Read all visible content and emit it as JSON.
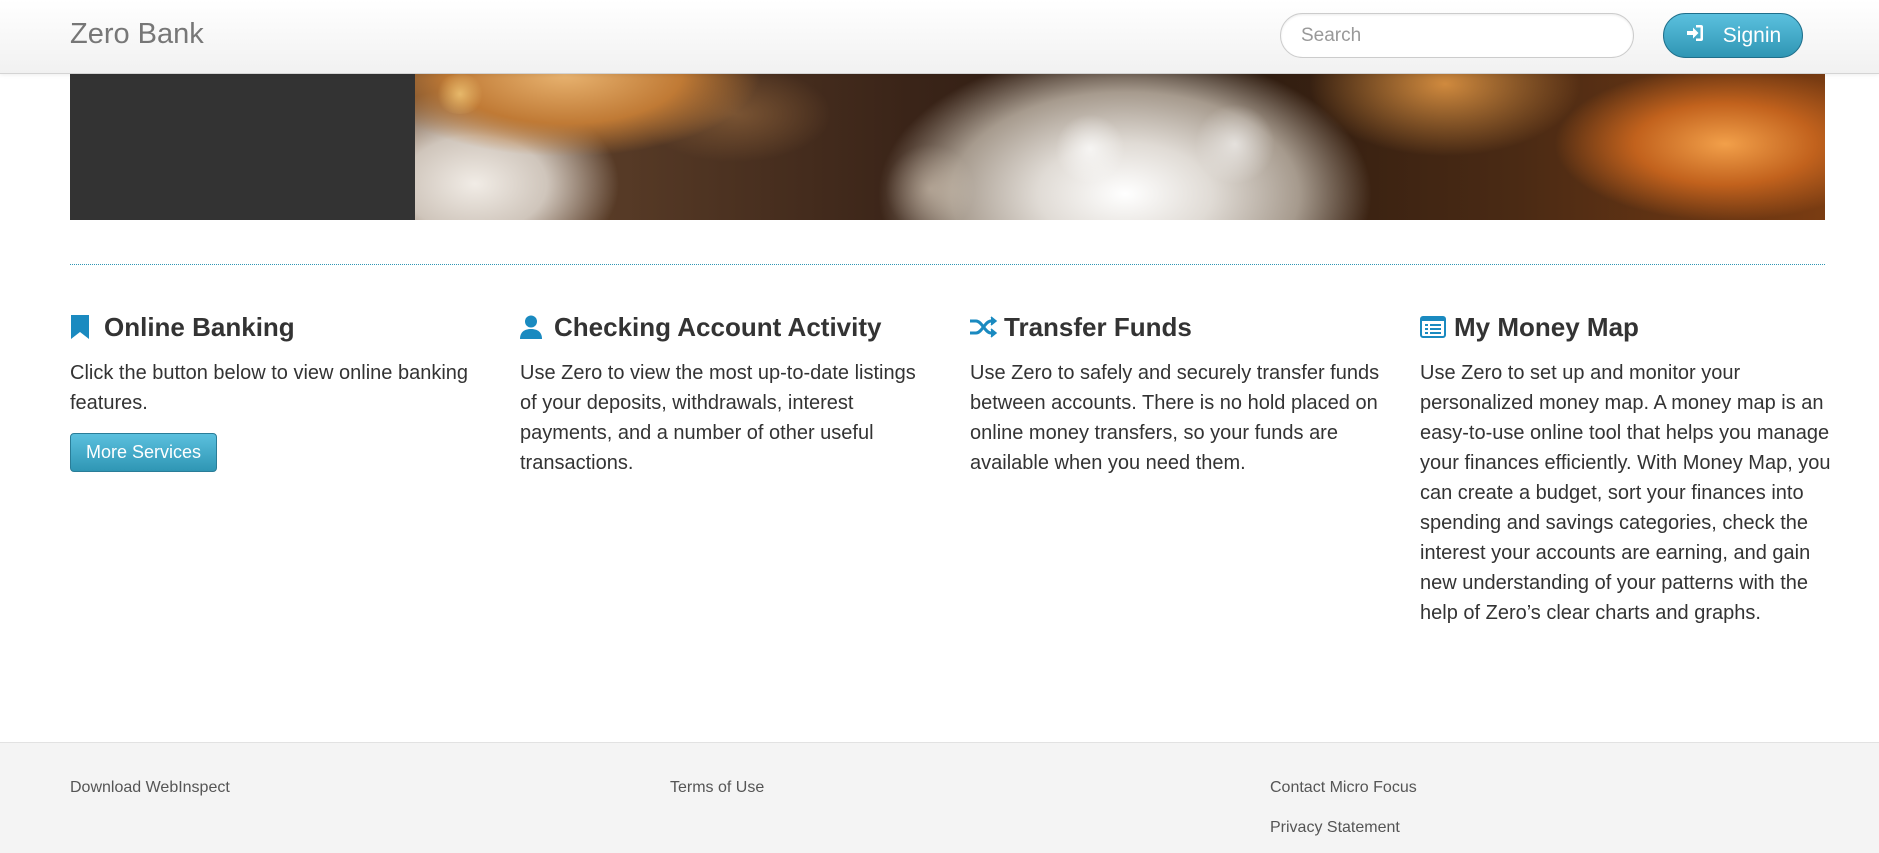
{
  "navbar": {
    "brand": "Zero Bank",
    "search_placeholder": "Search",
    "signin_label": "Signin"
  },
  "colors": {
    "accent": "#2f96b4",
    "accent_light": "#5bc0de",
    "icon": "#1a8ac0",
    "hero_dark": "#333333",
    "footer_bg": "#f4f4f4"
  },
  "features": [
    {
      "icon": "bookmark-icon",
      "title": "Online Banking",
      "text": "Click the button below to view online banking features.",
      "button": "More Services"
    },
    {
      "icon": "user-icon",
      "title": "Checking Account Activity",
      "text": "Use Zero to view the most up-to-date listings of your deposits, withdrawals, interest payments, and a number of other useful transactions."
    },
    {
      "icon": "shuffle-icon",
      "title": "Transfer Funds",
      "text": "Use Zero to safely and securely transfer funds between accounts. There is no hold placed on online money transfers, so your funds are available when you need them."
    },
    {
      "icon": "list-alt-icon",
      "title": "My Money Map",
      "text": "Use Zero to set up and monitor your personalized money map. A money map is an easy-to-use online tool that helps you manage your finances efficiently. With Money Map, you can create a budget, sort your finances into spending and savings categories, check the interest your accounts are earning, and gain new understanding of your patterns with the help of Zero’s clear charts and graphs."
    }
  ],
  "footer": {
    "download": "Download WebInspect",
    "terms": "Terms of Use",
    "contact": "Contact Micro Focus",
    "privacy": "Privacy Statement"
  }
}
